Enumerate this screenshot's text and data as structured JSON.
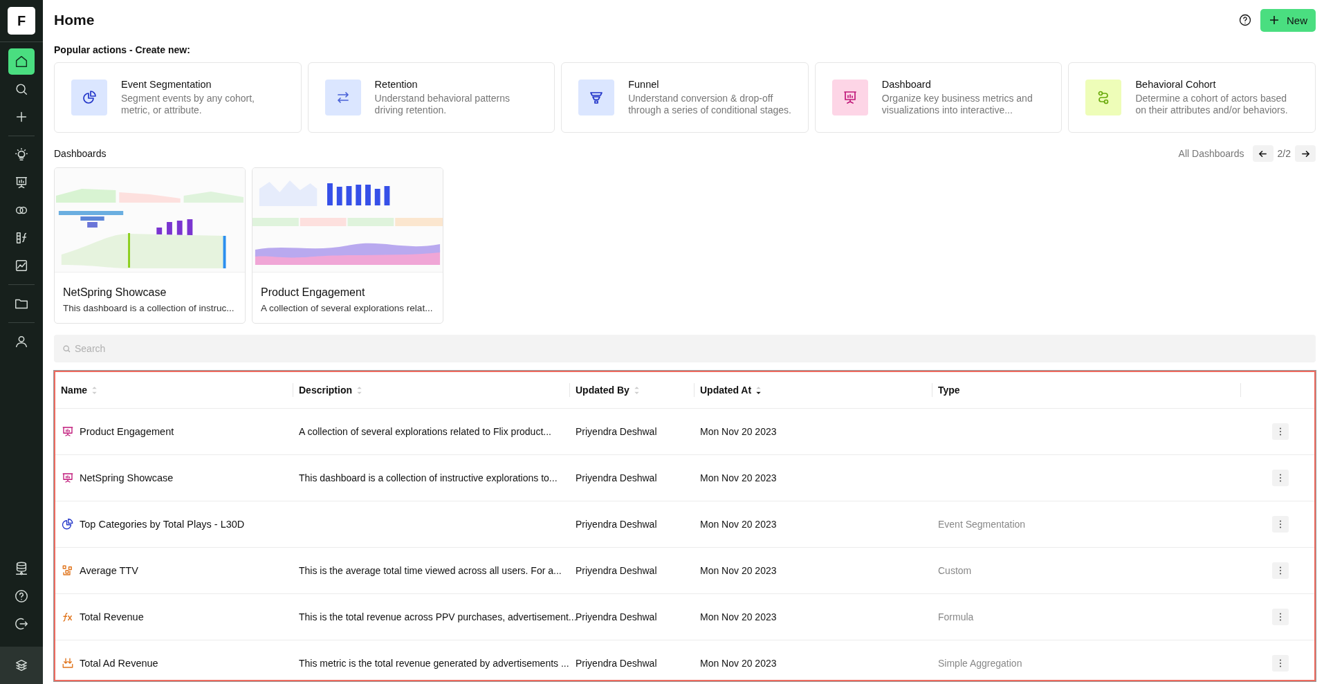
{
  "sidebar": {
    "logo": "F",
    "items": [
      {
        "kind": "home",
        "selected": true
      },
      {
        "kind": "search",
        "selected": false
      },
      {
        "kind": "plus",
        "selected": false
      },
      {
        "kind": "bulb",
        "selected": false
      },
      {
        "kind": "board",
        "selected": false
      },
      {
        "kind": "venn",
        "selected": false
      },
      {
        "kind": "formula",
        "selected": false
      },
      {
        "kind": "chart",
        "selected": false
      },
      {
        "kind": "folder",
        "selected": false
      },
      {
        "kind": "user",
        "selected": false
      }
    ],
    "bottom_items": [
      {
        "kind": "database"
      },
      {
        "kind": "help"
      },
      {
        "kind": "logout"
      }
    ]
  },
  "header": {
    "title": "Home",
    "new_button": "New"
  },
  "popular": {
    "title": "Popular actions - Create new:",
    "cards": [
      {
        "kind": "segmentation",
        "title": "Event Segmentation",
        "description": "Segment events by any cohort, metric, or attribute."
      },
      {
        "kind": "retention",
        "title": "Retention",
        "description": "Understand behavioral patterns driving retention."
      },
      {
        "kind": "funnel",
        "title": "Funnel",
        "description": "Understand conversion & drop-off through a series of conditional stages."
      },
      {
        "kind": "dashboard",
        "title": "Dashboard",
        "description": "Organize key business metrics and visualizations into interactive..."
      },
      {
        "kind": "cohort",
        "title": "Behavioral Cohort",
        "description": "Determine a cohort of actors based on their attributes and/or behaviors."
      }
    ]
  },
  "dashboards": {
    "title": "Dashboards",
    "all_link": "All Dashboards",
    "page": "2/2",
    "cards": [
      {
        "title": "NetSpring Showcase",
        "description": "This dashboard is a collection of instruc..."
      },
      {
        "title": "Product Engagement",
        "description": "A collection of several explorations relat..."
      }
    ]
  },
  "search": {
    "placeholder": "Search"
  },
  "table": {
    "columns": [
      {
        "label": "Name",
        "sortable": true,
        "sorted_descending": false
      },
      {
        "label": "Description",
        "sortable": true,
        "sorted_descending": false
      },
      {
        "label": "Updated By",
        "sortable": true,
        "sorted_descending": false
      },
      {
        "label": "Updated At",
        "sortable": true,
        "sorted_descending": true
      },
      {
        "label": "Type"
      }
    ],
    "rows": [
      {
        "kind": "dashboard",
        "name": "Product Engagement",
        "description": "A collection of several explorations related to Flix product...",
        "updated_by": "Priyendra Deshwal",
        "updated_at": "Mon Nov 20 2023"
      },
      {
        "kind": "dashboard",
        "name": "NetSpring Showcase",
        "description": "This dashboard is a collection of instructive explorations to...",
        "updated_by": "Priyendra Deshwal",
        "updated_at": "Mon Nov 20 2023"
      },
      {
        "kind": "segmentation",
        "name": "Top Categories by Total Plays - L30D",
        "updated_by": "Priyendra Deshwal",
        "updated_at": "Mon Nov 20 2023",
        "type": "Event Segmentation"
      },
      {
        "kind": "custom",
        "name": "Average TTV",
        "description": "This is the average total time viewed across all users. For a...",
        "updated_by": "Priyendra Deshwal",
        "updated_at": "Mon Nov 20 2023",
        "type": "Custom"
      },
      {
        "kind": "formula",
        "name": "Total Revenue",
        "description": "This is the total revenue across PPV purchases, advertisement...",
        "updated_by": "Priyendra Deshwal",
        "updated_at": "Mon Nov 20 2023",
        "type": "Formula"
      },
      {
        "kind": "aggregation",
        "name": "Total Ad Revenue",
        "description": "This metric is the total revenue generated by advertisements ...",
        "updated_by": "Priyendra Deshwal",
        "updated_at": "Mon Nov 20 2023",
        "type": "Simple Aggregation"
      }
    ]
  }
}
